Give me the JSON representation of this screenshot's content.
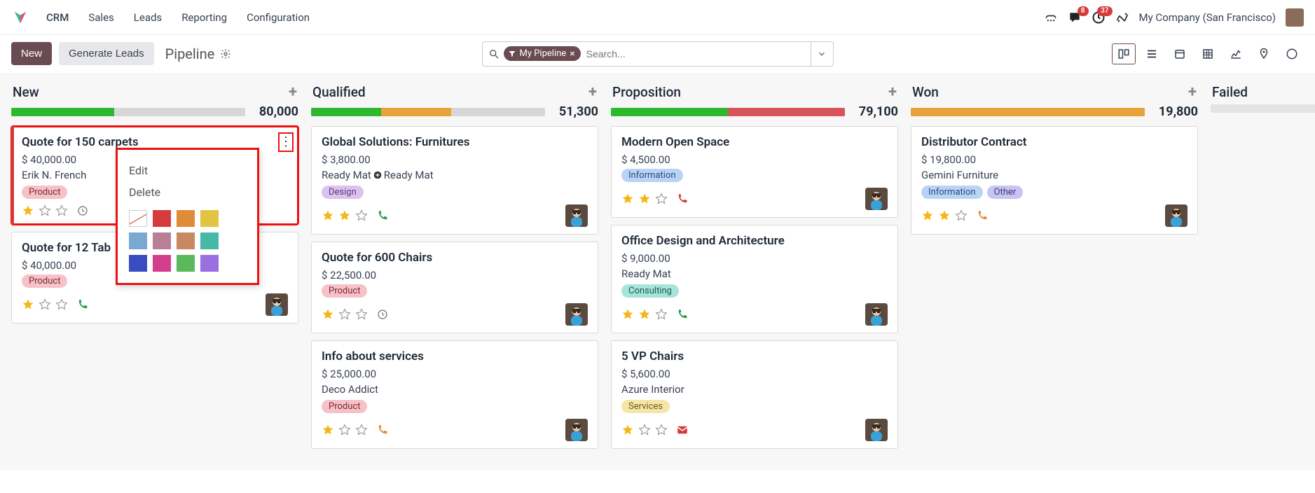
{
  "nav": {
    "app": "CRM",
    "items": [
      "Sales",
      "Leads",
      "Reporting",
      "Configuration"
    ],
    "badges": {
      "messages": "8",
      "activities": "37"
    },
    "company": "My Company (San Francisco)"
  },
  "controls": {
    "new_label": "New",
    "gen_label": "Generate Leads",
    "breadcrumb": "Pipeline",
    "filter_label": "My Pipeline",
    "search_placeholder": "Search..."
  },
  "popover": {
    "edit": "Edit",
    "delete": "Delete",
    "colors": [
      "none",
      "#d63b3b",
      "#e08b36",
      "#e3c342",
      "#79a8d0",
      "#b97f96",
      "#c88862",
      "#46b8a8",
      "#3a4cc2",
      "#d43f8d",
      "#5cb85c",
      "#9a6fe0"
    ]
  },
  "columns": [
    {
      "title": "New",
      "amount": "80,000",
      "progress": [
        {
          "color": "#2eb82e",
          "pct": 44
        },
        {
          "color": "#d7d7d7",
          "pct": 56
        }
      ],
      "cards": [
        {
          "title": "Quote for 150 carpets",
          "amount": "$ 40,000.00",
          "sub": "Erik N. French",
          "tags": [
            {
              "text": "Product",
              "cls": "product"
            }
          ],
          "stars": 1,
          "extra_icon": "clock",
          "avatar": false,
          "selected": true,
          "kebab": true,
          "popover": true
        },
        {
          "title": "Quote for 12 Tab",
          "amount": "$ 40,000.00",
          "sub": "",
          "tags": [
            {
              "text": "Product",
              "cls": "product"
            }
          ],
          "stars": 1,
          "extra_icon": "phone-green",
          "avatar": true
        }
      ]
    },
    {
      "title": "Qualified",
      "amount": "51,300",
      "progress": [
        {
          "color": "#2eb82e",
          "pct": 30
        },
        {
          "color": "#e8a23a",
          "pct": 30
        },
        {
          "color": "#d7d7d7",
          "pct": 40
        }
      ],
      "cards": [
        {
          "title": "Global Solutions: Furnitures",
          "amount": "$ 3,800.00",
          "sub": "Ready Mat⊕Ready Mat",
          "tags": [
            {
              "text": "Design",
              "cls": "design"
            }
          ],
          "stars": 2,
          "extra_icon": "phone-green",
          "avatar": true
        },
        {
          "title": "Quote for 600 Chairs",
          "amount": "$ 22,500.00",
          "sub": "",
          "tags": [
            {
              "text": "Product",
              "cls": "product"
            }
          ],
          "stars": 1,
          "extra_icon": "clock",
          "avatar": true
        },
        {
          "title": "Info about services",
          "amount": "$ 25,000.00",
          "sub": "Deco Addict",
          "tags": [
            {
              "text": "Product",
              "cls": "product"
            }
          ],
          "stars": 1,
          "extra_icon": "phone-orange",
          "avatar": true
        }
      ]
    },
    {
      "title": "Proposition",
      "amount": "79,100",
      "progress": [
        {
          "color": "#2eb82e",
          "pct": 50
        },
        {
          "color": "#d8545b",
          "pct": 50
        }
      ],
      "cards": [
        {
          "title": "Modern Open Space",
          "amount": "$ 4,500.00",
          "sub": "",
          "tags": [
            {
              "text": "Information",
              "cls": "info"
            }
          ],
          "stars": 2,
          "extra_icon": "phone-red",
          "avatar": true
        },
        {
          "title": "Office Design and Architecture",
          "amount": "$ 9,000.00",
          "sub": "Ready Mat",
          "tags": [
            {
              "text": "Consulting",
              "cls": "consulting"
            }
          ],
          "stars": 2,
          "extra_icon": "phone-green",
          "avatar": true
        },
        {
          "title": "5 VP Chairs",
          "amount": "$ 5,600.00",
          "sub": "Azure Interior",
          "tags": [
            {
              "text": "Services",
              "cls": "services"
            }
          ],
          "stars": 1,
          "extra_icon": "mail-red",
          "avatar": true
        }
      ]
    },
    {
      "title": "Won",
      "amount": "19,800",
      "progress": [
        {
          "color": "#e8a23a",
          "pct": 100
        }
      ],
      "cards": [
        {
          "title": "Distributor Contract",
          "amount": "$ 19,800.00",
          "sub": "Gemini Furniture",
          "tags": [
            {
              "text": "Information",
              "cls": "info"
            },
            {
              "text": "Other",
              "cls": "other"
            }
          ],
          "stars": 2,
          "extra_icon": "phone-orange",
          "avatar": true
        }
      ]
    },
    {
      "title": "Failed",
      "amount": "",
      "progress": [
        {
          "color": "#e4e4e4",
          "pct": 100
        }
      ],
      "cards": []
    }
  ]
}
